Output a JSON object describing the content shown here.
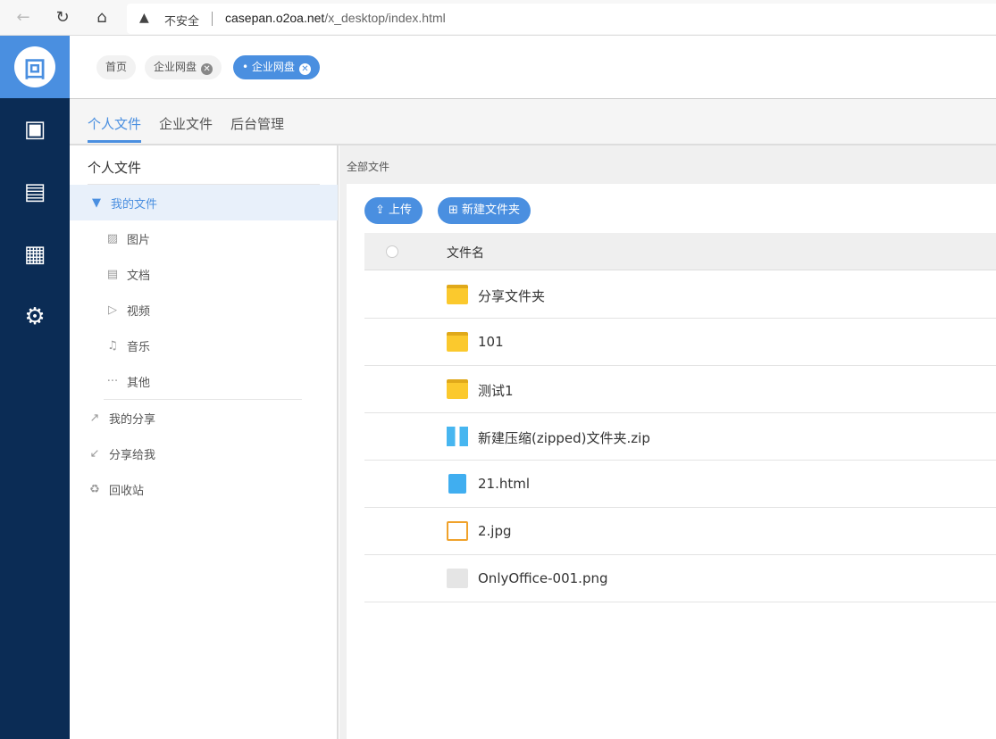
{
  "browser": {
    "back": "←",
    "reload": "↻",
    "home": "⌂",
    "warning": "▲",
    "insecure": "不安全",
    "url_host": "casepan.o2oa.net",
    "url_path": "/x_desktop/index.html"
  },
  "leftnav": {
    "logo": "回",
    "icons": [
      "desktop-user-icon",
      "calendar-news-icon",
      "calendar-icon",
      "user-settings-icon"
    ]
  },
  "topbar": {
    "chips": [
      {
        "label": "首页"
      },
      {
        "label": "企业网盘",
        "close": "✕"
      },
      {
        "label": "• 企业网盘",
        "close": "✕",
        "active": true
      }
    ]
  },
  "tabs": [
    {
      "label": "个人文件",
      "active": true
    },
    {
      "label": "企业文件"
    },
    {
      "label": "后台管理"
    }
  ],
  "sidebar": {
    "title": "个人文件",
    "my_files": "我的文件",
    "sub": [
      {
        "label": "图片",
        "icon": "▨"
      },
      {
        "label": "文档",
        "icon": "▤"
      },
      {
        "label": "视频",
        "icon": "▷"
      },
      {
        "label": "音乐",
        "icon": "♫"
      },
      {
        "label": "其他",
        "icon": "···"
      }
    ],
    "items": [
      {
        "label": "我的分享",
        "icon": "↗"
      },
      {
        "label": "分享给我",
        "icon": "↙"
      },
      {
        "label": "回收站",
        "icon": "♻"
      }
    ]
  },
  "main": {
    "breadcrumb": "全部文件",
    "upload": "上传",
    "new_folder": "新建文件夹",
    "column_name": "文件名",
    "files": [
      {
        "name": "分享文件夹",
        "type": "folder"
      },
      {
        "name": "101",
        "type": "folder"
      },
      {
        "name": "测试1",
        "type": "folder"
      },
      {
        "name": "新建压缩(zipped)文件夹.zip",
        "type": "zip"
      },
      {
        "name": "21.html",
        "type": "html"
      },
      {
        "name": "2.jpg",
        "type": "jpg"
      },
      {
        "name": "OnlyOffice-001.png",
        "type": "png"
      }
    ]
  },
  "colors": {
    "accent": "#4a8fe0",
    "nav": "#0b2c55"
  }
}
